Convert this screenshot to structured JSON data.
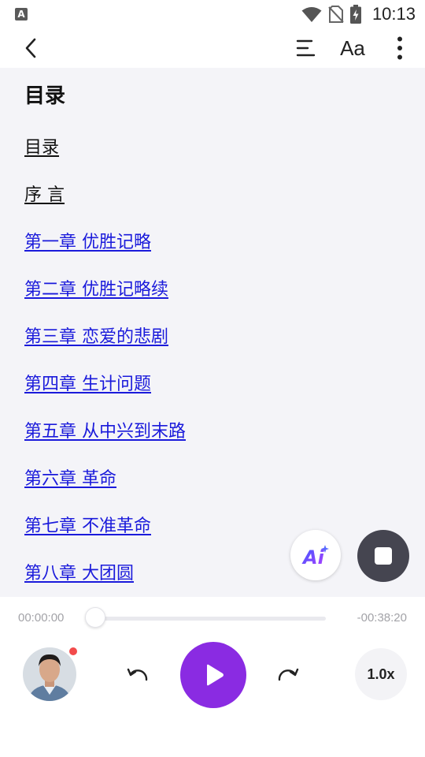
{
  "status_bar": {
    "app_icon_letter": "A",
    "time": "10:13",
    "icons": [
      "wifi-icon",
      "no-sim-icon",
      "battery-charging-icon"
    ]
  },
  "toolbar": {
    "back_icon": "back-arrow-icon",
    "toc_icon": "toc-list-icon",
    "font_button_label": "Aa",
    "more_icon": "more-vert-icon"
  },
  "toc": {
    "title": "目录",
    "items": [
      {
        "label": "目录",
        "style": "plain"
      },
      {
        "label": "序 言",
        "style": "plain"
      },
      {
        "label": "第一章 优胜记略",
        "style": "link"
      },
      {
        "label": "第二章 优胜记略续",
        "style": "link"
      },
      {
        "label": "第三章 恋爱的悲剧",
        "style": "link"
      },
      {
        "label": "第四章 生计问题",
        "style": "link"
      },
      {
        "label": "第五章 从中兴到末路",
        "style": "link"
      },
      {
        "label": "第六章 革命",
        "style": "link"
      },
      {
        "label": "第七章 不准革命",
        "style": "link"
      },
      {
        "label": "第八章 大团圆",
        "style": "link"
      }
    ]
  },
  "floating": {
    "ai_label": "Ai",
    "stop_icon": "stop-icon"
  },
  "player": {
    "elapsed": "00:00:00",
    "remaining": "-00:38:20",
    "progress": 0.0,
    "speed": "1.0x",
    "play_icon": "play-icon",
    "rewind_icon": "rewind-icon",
    "forward_icon": "forward-icon"
  },
  "colors": {
    "accent": "#8a2be2",
    "link": "#1a1adb",
    "content_bg": "#f4f4f8",
    "stop_button": "#454550",
    "notification_dot": "#f24b4b"
  }
}
